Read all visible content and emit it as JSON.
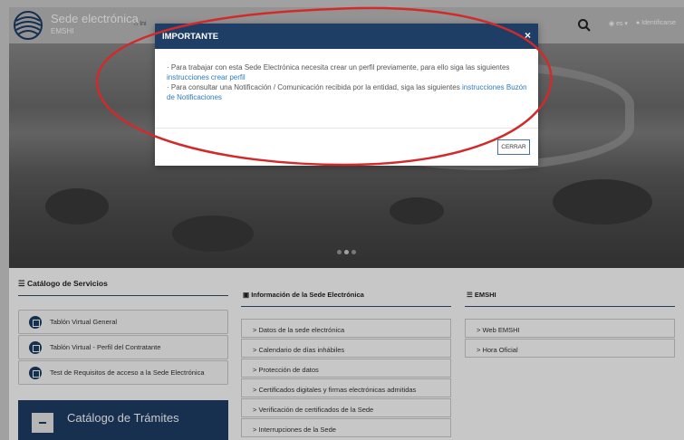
{
  "header": {
    "brand": "Sede electrónica",
    "brand_sub": "EMSHI",
    "home_label": "Ini",
    "lang_label": "es",
    "ident_label": "Identificarse"
  },
  "modal": {
    "title": "IMPORTANTE",
    "close_symbol": "×",
    "line1": "· Para trabajar con esta Sede Electrónica necesita crear un perfil previamente, para ello siga las siguientes",
    "link1": "instrucciones crear perfil",
    "line2": "· Para consultar una Notificación / Comunicación recibida por la entidad, siga las siguientes",
    "link2": "instrucciones Buzón de Notificaciones",
    "button": "CERRAR"
  },
  "catalogo_servicios": {
    "title": "Catálogo de Servicios",
    "items": [
      {
        "label": "Tablón Virtual General"
      },
      {
        "label": "Tablón Virtual - Perfil del Contratante"
      },
      {
        "label": "Test de Requisitos de acceso a la Sede Electrónica"
      }
    ]
  },
  "catalogo_tramites": {
    "title": "Catálogo de Trámites"
  },
  "info_sede": {
    "title": "Información de la Sede Electrónica",
    "items": [
      {
        "label": "Datos de la sede electrónica"
      },
      {
        "label": "Calendario de días inhábiles"
      },
      {
        "label": "Protección de datos"
      },
      {
        "label": "Certificados digitales y firmas electrónicas admitidas"
      },
      {
        "label": "Verificación de certificados de la Sede"
      },
      {
        "label": "Interrupciones de la Sede"
      }
    ]
  },
  "emshi": {
    "title": "EMSHI",
    "items": [
      {
        "label": "Web EMSHI"
      },
      {
        "label": "Hora Oficial"
      }
    ]
  },
  "colors": {
    "navy": "#1f3e66",
    "link": "#2b7bc1",
    "annotation": "#d22a2a"
  }
}
